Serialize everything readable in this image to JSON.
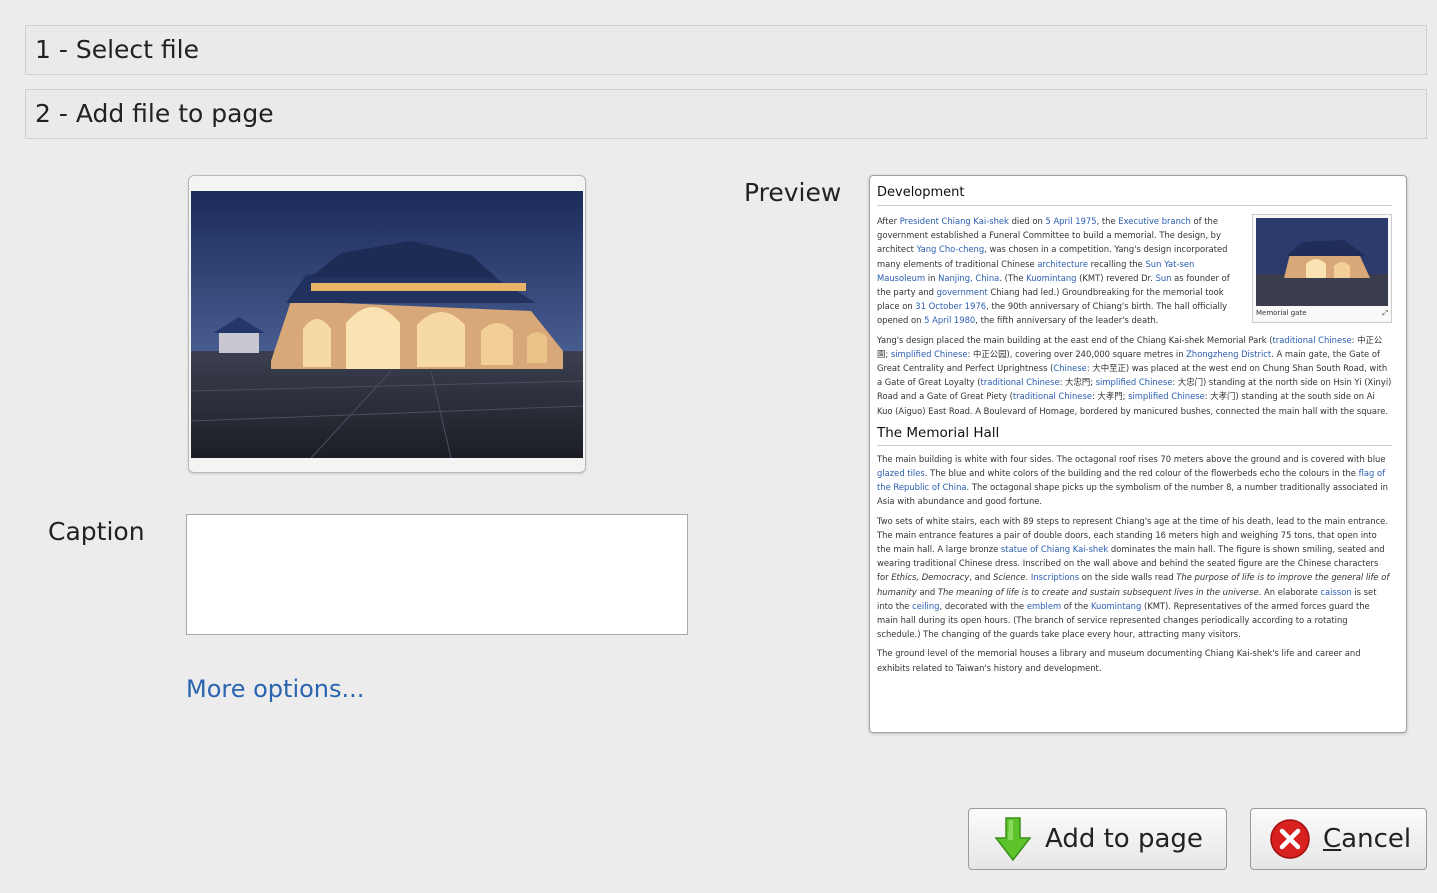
{
  "steps": [
    {
      "label": "1 - Select file"
    },
    {
      "label": "2 - Add file to page"
    }
  ],
  "form": {
    "caption_label": "Caption",
    "caption_value": "",
    "more_options": "More options..."
  },
  "preview": {
    "label": "Preview",
    "heading": "Development",
    "thumb_caption": "Memorial gate",
    "section_heading": "The Memorial Hall"
  },
  "buttons": {
    "add_label": "Add to page",
    "cancel_accel": "C",
    "cancel_rest": "ancel"
  },
  "icons": {
    "add": "green-down-arrow-icon",
    "cancel": "red-x-circle-icon",
    "image": "memorial-gate-photo"
  },
  "colors": {
    "link": "#2a64b0",
    "arrow": "#5cc42a",
    "cancel": "#d8201e"
  }
}
